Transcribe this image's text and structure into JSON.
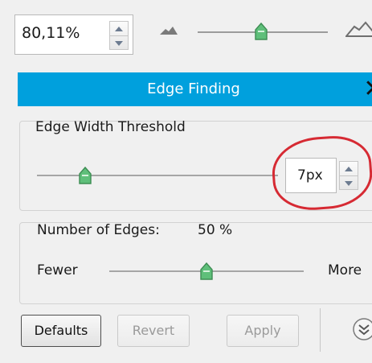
{
  "zoom": {
    "value": "80,11%",
    "slider_level": 0.49
  },
  "panel": {
    "title": "Edge Finding",
    "close_glyph": "✕"
  },
  "edge_width": {
    "label": "Edge Width Threshold",
    "value": "7px",
    "slider_level": 0.2
  },
  "edges": {
    "label": "Number of Edges:",
    "percent": "50 %",
    "min_label": "Fewer",
    "max_label": "More",
    "slider_level": 0.5
  },
  "buttons": {
    "defaults": "Defaults",
    "revert": "Revert",
    "apply": "Apply"
  },
  "icons": {
    "zoom_out": "mountain-small-icon",
    "zoom_in": "mountain-large-icon",
    "expand": "double-chevron-down-icon"
  },
  "colors": {
    "header": "#00a0dd",
    "annotation": "#d62a33",
    "thumb": "#49a86a"
  }
}
